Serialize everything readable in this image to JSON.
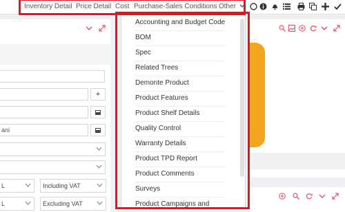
{
  "tabs": [
    {
      "label": "Inventory Detail"
    },
    {
      "label": "Price Detail"
    },
    {
      "label": "Cost"
    },
    {
      "label": "Purchase-Sales Conditions"
    },
    {
      "label": "Other"
    }
  ],
  "menu": {
    "items": [
      "Accounting and Budget Codes",
      "BOM",
      "Spec",
      "Related Trees",
      "Demonte Product",
      "Product Features",
      "Product Shelf Details",
      "Quality Control",
      "Warranty Details",
      "Product TPD Report",
      "Product Comments",
      "Surveys",
      "Product Campaigns and"
    ]
  },
  "left": {
    "field_partial_text": "ani",
    "add_button": "+",
    "select_l1": "L",
    "select_l2": "L",
    "vat1": "Including VAT",
    "vat2": "Excluding VAT"
  },
  "colors": {
    "highlight": "#e8141c",
    "accent": "#e0506b"
  }
}
